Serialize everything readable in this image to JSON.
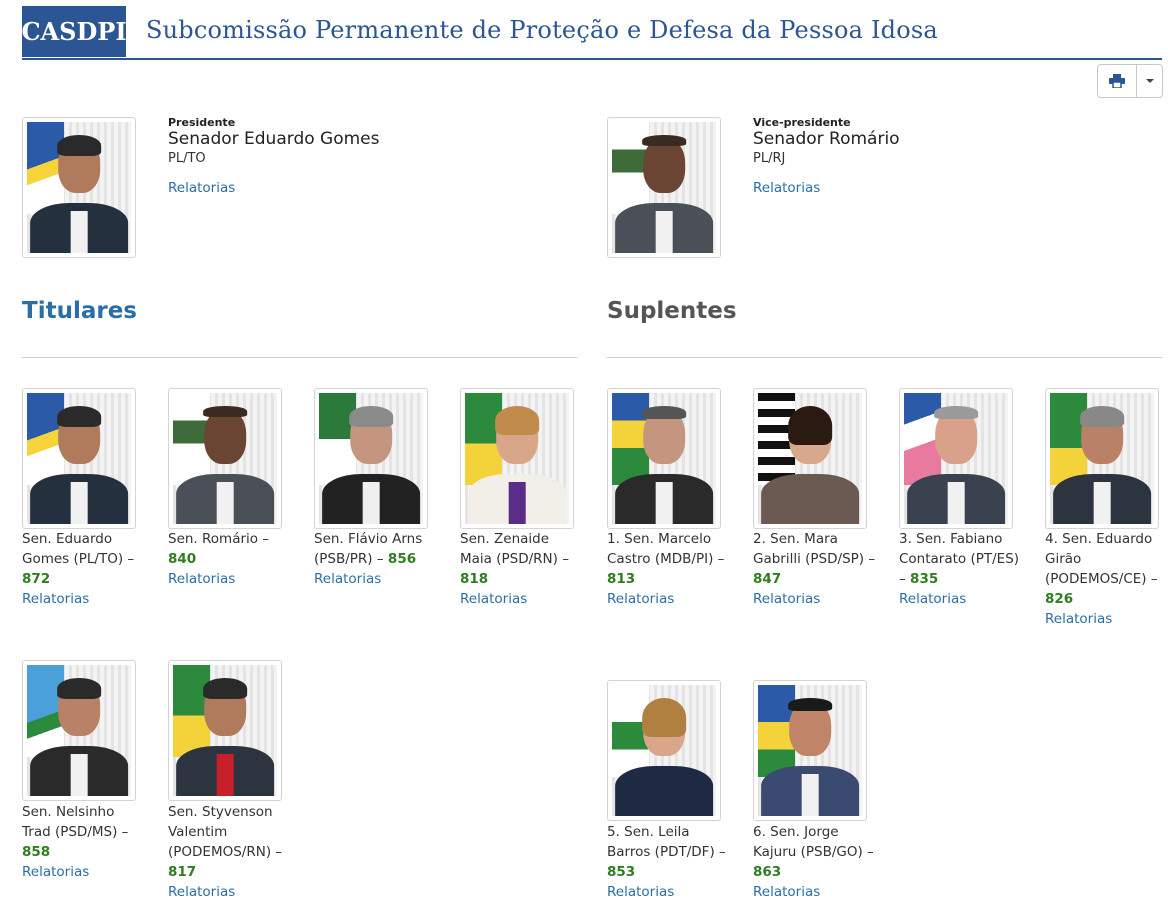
{
  "header": {
    "abbr": "CASDPI",
    "title": "Subcomissão Permanente de Proteção e Defesa da Pessoa Idosa"
  },
  "toolbar": {
    "print_icon": "print-icon",
    "dropdown_icon": "caret-down-icon"
  },
  "leaders": [
    {
      "role": "Presidente",
      "name": "Senador Eduardo Gomes",
      "party": "PL/TO",
      "link": "Relatorias"
    },
    {
      "role": "Vice-presidente",
      "name": "Senador Romário",
      "party": "PL/RJ",
      "link": "Relatorias"
    }
  ],
  "titulares": {
    "heading": "Titulares",
    "members": [
      {
        "prefix": "Sen. Eduardo Gomes (PL/TO) – ",
        "score": "872",
        "link": "Relatorias"
      },
      {
        "prefix": "Sen. Romário – ",
        "score": "840",
        "link": "Relatorias"
      },
      {
        "prefix": "Sen. Flávio Arns (PSB/PR) – ",
        "score": "856",
        "link": "Relatorias"
      },
      {
        "prefix": "Sen. Zenaide Maia (PSD/RN) – ",
        "score": "818",
        "link": "Relatorias"
      },
      {
        "prefix": "Sen. Nelsinho Trad (PSD/MS) – ",
        "score": "858",
        "link": "Relatorias"
      },
      {
        "prefix": "Sen. Styvenson Valentim (PODEMOS/RN) – ",
        "score": "817",
        "link": "Relatorias"
      }
    ]
  },
  "suplentes": {
    "heading": "Suplentes",
    "members": [
      {
        "prefix": "1. Sen. Marcelo Castro (MDB/PI) – ",
        "score": "813",
        "link": "Relatorias"
      },
      {
        "prefix": "2. Sen. Mara Gabrilli (PSD/SP) – ",
        "score": "847",
        "link": "Relatorias"
      },
      {
        "prefix": "3. Sen. Fabiano Contarato (PT/ES) – ",
        "score": "835",
        "link": "Relatorias"
      },
      {
        "prefix": "4. Sen. Eduardo Girão (PODEMOS/CE) – ",
        "score": "826",
        "link": "Relatorias"
      },
      {
        "prefix": "5. Sen. Leila Barros (PDT/DF) – ",
        "score": "853",
        "link": "Relatorias"
      },
      {
        "prefix": "6. Sen. Jorge Kajuru (PSB/GO) – ",
        "score": "863",
        "link": "Relatorias"
      }
    ]
  },
  "colors": {
    "brand": "#2c5593",
    "link": "#2b6ea6",
    "score": "#2e7d1f",
    "suplentes_heading": "#555555"
  }
}
